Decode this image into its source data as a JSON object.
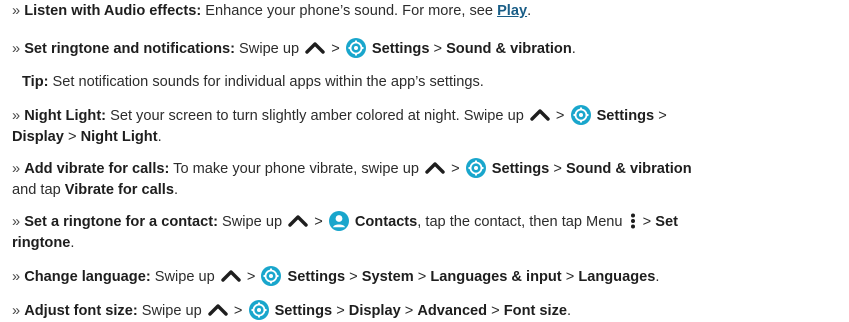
{
  "items": [
    {
      "bullet": "»",
      "term": "Listen with Audio effects:",
      "text": " Enhance your phone’s sound. For more, see ",
      "link": "Play",
      "end": "."
    },
    {
      "bullet": "»",
      "term": "Set ringtone and notifications:",
      "pre": " Swipe up ",
      "sep1": " > ",
      "settings": "Settings",
      "sep2": " > ",
      "dest": "Sound & vibration",
      "end": "."
    },
    {
      "tip_label": "Tip:",
      "tip_text": " Set notification sounds for individual apps within the app’s settings."
    },
    {
      "bullet": "»",
      "term": "Night Light:",
      "text": " Set your screen to turn slightly amber colored at night. Swipe up ",
      "sep1": " > ",
      "settings": "Settings",
      "sep2": " >",
      "line2_a": "Display",
      "sep3": " > ",
      "line2_b": "Night Light",
      "end": "."
    },
    {
      "bullet": "»",
      "term": "Add vibrate for calls:",
      "text": " To make your phone vibrate, swipe up ",
      "sep1": " > ",
      "settings": "Settings",
      "sep2": " > ",
      "dest": "Sound & vibration",
      "line2_pre": "and tap ",
      "line2_b": "Vibrate for calls",
      "end": "."
    },
    {
      "bullet": "»",
      "term": "Set a ringtone for a contact:",
      "pre": " Swipe up ",
      "sep1": " > ",
      "contacts": "Contacts",
      "mid": ", tap the contact, then tap Menu ",
      "sep2": " > ",
      "dest": "Set",
      "line2_b": "ringtone",
      "end": "."
    },
    {
      "bullet": "»",
      "term": "Change language:",
      "pre": " Swipe up ",
      "sep1": " > ",
      "settings": "Settings",
      "sep2": " > ",
      "a": "System",
      "sep3": " > ",
      "b": "Languages & input",
      "sep4": " > ",
      "c": "Languages",
      "end": "."
    },
    {
      "bullet": "»",
      "term": "Adjust font size:",
      "pre": " Swipe up ",
      "sep1": " > ",
      "settings": "Settings",
      "sep2": " > ",
      "a": "Display",
      "sep3": " > ",
      "b": "Advanced",
      "sep4": " > ",
      "c": "Font size",
      "end": "."
    }
  ],
  "icons": {
    "swipe": "chevron-up-icon",
    "settings": "settings-gear-icon",
    "contacts": "contacts-person-icon",
    "menu": "menu-dots-icon"
  },
  "colors": {
    "text": "#2c2c2c",
    "link": "#1a5e87",
    "icon": "#19a6cc"
  }
}
